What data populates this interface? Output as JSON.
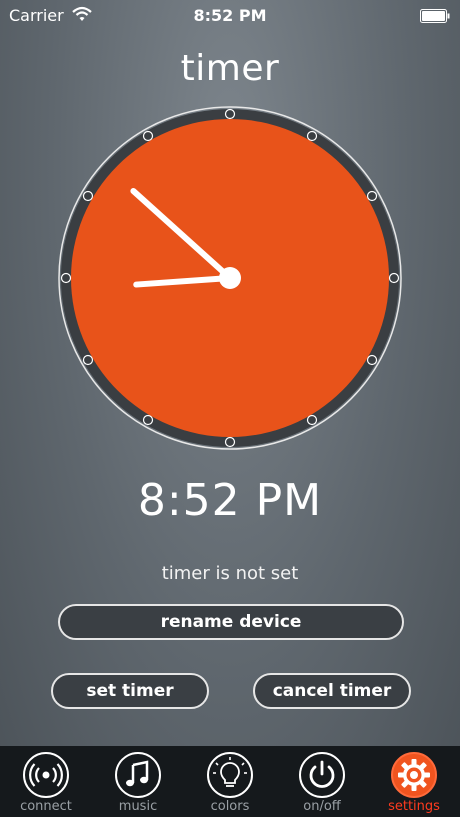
{
  "status_bar": {
    "carrier": "Carrier",
    "time": "8:52 PM"
  },
  "header": {
    "title": "timer"
  },
  "clock": {
    "time": "8:52 PM",
    "accent": "#e8531a",
    "rim": "#3a3e42"
  },
  "timer_status": "timer is not set",
  "buttons": {
    "rename": "rename device",
    "set_timer": "set timer",
    "cancel_timer": "cancel timer"
  },
  "tabs": [
    {
      "label": "connect",
      "icon": "wireless-signal-icon",
      "active": false
    },
    {
      "label": "music",
      "icon": "music-note-icon",
      "active": false
    },
    {
      "label": "colors",
      "icon": "lightbulb-icon",
      "active": false
    },
    {
      "label": "on/off",
      "icon": "power-icon",
      "active": false
    },
    {
      "label": "settings",
      "icon": "gear-icon",
      "active": true
    }
  ],
  "colors": {
    "active_tab": "#ff3b1f",
    "active_tab_icon_bg": "#f0541f"
  }
}
